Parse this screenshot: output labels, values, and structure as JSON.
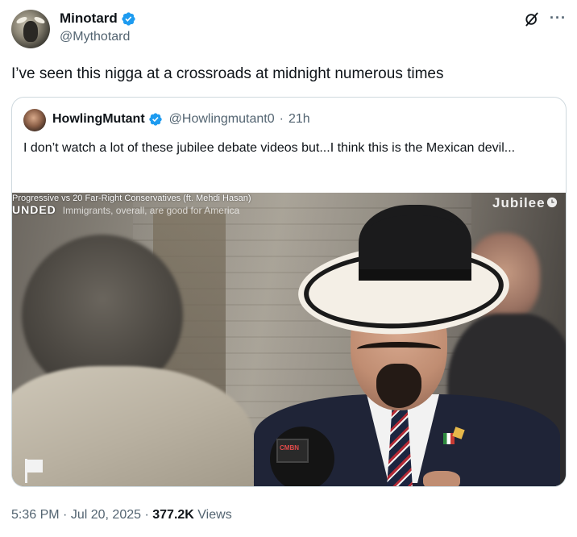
{
  "tweet": {
    "author": {
      "name": "Minotard",
      "handle": "@Mythotard"
    },
    "text": "I’ve seen this nigga at a crossroads at midnight numerous times",
    "time": "5:36 PM",
    "date": "Jul 20, 2025",
    "views_count": "377.2K",
    "views_label": "Views"
  },
  "quote": {
    "author": {
      "name": "HowlingMutant",
      "handle": "@Howlingmutant0",
      "age": "21h"
    },
    "text": "I don’t watch a lot of these jubilee debate videos but...I think this is the Mexican devil...",
    "video": {
      "title": "Progressive vs 20 Far-Right Conservatives (ft. Mehdi Hasan)",
      "brand": "UNDED",
      "caption": "Immigrants, overall, are good for America",
      "logo": "Jubilee"
    }
  },
  "icons": {
    "verified": "verified-badge-icon",
    "grok": "grok-icon",
    "more": "more-icon",
    "flag": "flag-icon"
  },
  "colors": {
    "verified": "#1d9bf0",
    "secondary_text": "#536471",
    "border": "#cfd9de"
  }
}
